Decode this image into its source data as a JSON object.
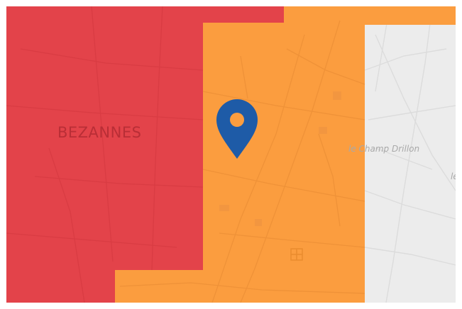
{
  "map": {
    "labels": {
      "town": "BEZANNES",
      "locality": "le Champ Drillon",
      "edge_fragment": "le"
    },
    "marker_icon": "map-pin-icon",
    "poi_icon": "building-square-icon",
    "colors": {
      "zone_red": "#e3434a",
      "zone_orange": "#fb9d3f",
      "zone_grey": "#ececec",
      "marker": "#1e5ba7",
      "label_on_red": "#b92e36",
      "label_on_grey": "#a9a9a9",
      "roads_on_orange": "#e98a2e"
    }
  }
}
